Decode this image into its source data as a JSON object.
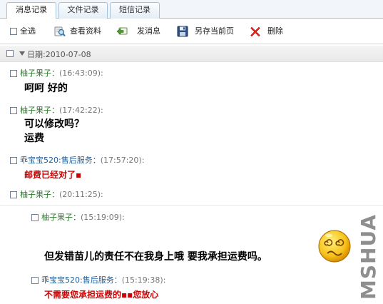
{
  "tabs": [
    {
      "label": "消息记录",
      "active": true
    },
    {
      "label": "文件记录",
      "active": false
    },
    {
      "label": "短信记录",
      "active": false
    }
  ],
  "toolbar": {
    "select_all": "全选",
    "view_profile": "查看资料",
    "send_message": "发消息",
    "save_page": "另存当前页",
    "delete": "删除"
  },
  "date_header": "日期:2010-07-08",
  "messages": [
    {
      "sender": "柚子果子",
      "time": "(16:43:09):",
      "lines": [
        "呵呵  好的"
      ]
    },
    {
      "sender": "柚子果子",
      "time": "(17:42:22):",
      "lines": [
        "可以修改吗？",
        "运费"
      ]
    },
    {
      "sender": "乖宝宝520:售后服务",
      "time": "(17:57:20):",
      "lines": [
        "邮费已经对了▪"
      ]
    },
    {
      "sender": "柚子果子",
      "time": "(20:11:25):",
      "lines": []
    },
    {
      "sender": "柚子果子",
      "time": "(15:19:09):",
      "lines": [
        "但发错苗儿的责任不在我身上哦  要我承担运费吗。"
      ]
    },
    {
      "sender": "乖宝宝520:售后服务",
      "time": "(15:19:38):",
      "lines": [
        "不需要您承担运费的▪▪您放心"
      ]
    }
  ],
  "watermark": "MSHUA",
  "colors": {
    "sender_self": "#2d7b2d",
    "sender_service": "#1e5d9c",
    "service_text": "#d00000"
  },
  "icons": {
    "view_profile": "magnifier-user-icon",
    "send_message": "send-arrow-icon",
    "save_page": "floppy-disk-icon",
    "delete": "red-x-icon",
    "emoticon": "dizzy-face-emoticon"
  }
}
